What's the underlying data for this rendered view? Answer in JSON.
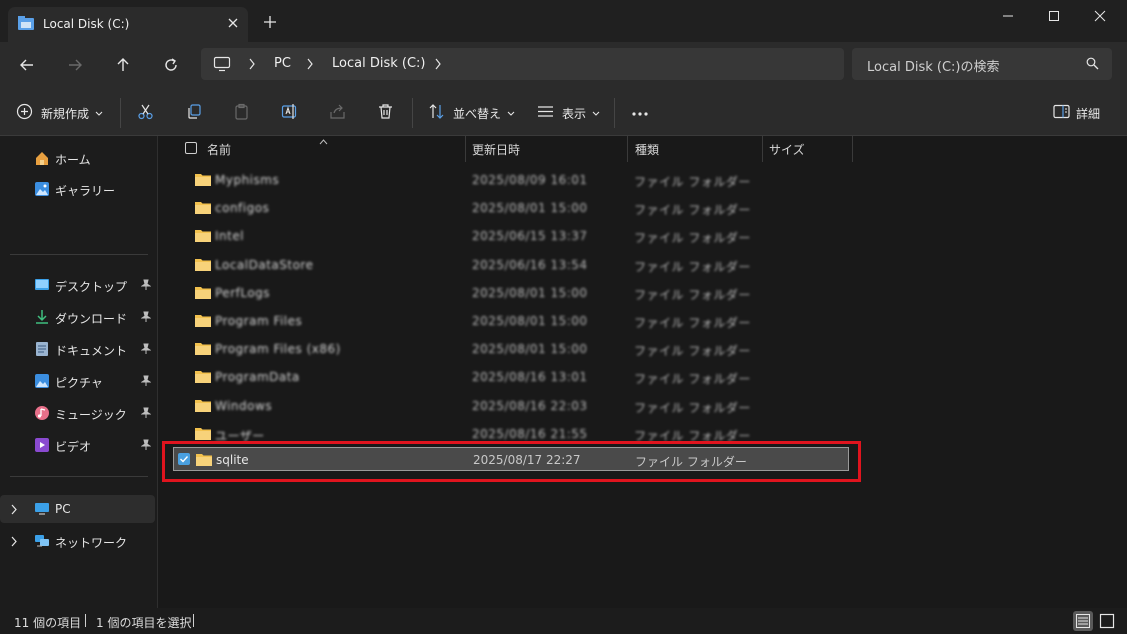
{
  "window": {
    "tab_title": "Local Disk (C:)",
    "controls": [
      "minimize-icon",
      "maximize-icon",
      "close-icon"
    ]
  },
  "nav": {
    "breadcrumb": [
      "PC",
      "Local Disk (C:)"
    ],
    "search_placeholder": "Local Disk (C:)の検索"
  },
  "toolbar": {
    "new_label": "新規作成",
    "sort_label": "並べ替え",
    "view_label": "表示",
    "details_label": "詳細"
  },
  "sidebar": {
    "top": [
      {
        "label": "ホーム",
        "icon": "home-icon"
      },
      {
        "label": "ギャラリー",
        "icon": "gallery-icon"
      }
    ],
    "pinned": [
      {
        "label": "デスクトップ",
        "icon": "desktop-icon"
      },
      {
        "label": "ダウンロード",
        "icon": "download-icon"
      },
      {
        "label": "ドキュメント",
        "icon": "document-icon"
      },
      {
        "label": "ピクチャ",
        "icon": "pictures-icon"
      },
      {
        "label": "ミュージック",
        "icon": "music-icon"
      },
      {
        "label": "ビデオ",
        "icon": "video-icon"
      }
    ],
    "locations": [
      {
        "label": "PC",
        "icon": "pc-icon"
      },
      {
        "label": "ネットワーク",
        "icon": "network-icon"
      }
    ]
  },
  "columns": {
    "name": "名前",
    "modified": "更新日時",
    "type": "種類",
    "size": "サイズ"
  },
  "files": [
    {
      "name": "Myphisms",
      "date": "2025/08/09 16:01",
      "type": "ファイル フォルダー"
    },
    {
      "name": "configos",
      "date": "2025/08/01 15:00",
      "type": "ファイル フォルダー"
    },
    {
      "name": "Intel",
      "date": "2025/06/15 13:37",
      "type": "ファイル フォルダー"
    },
    {
      "name": "LocalDataStore",
      "date": "2025/06/16 13:54",
      "type": "ファイル フォルダー"
    },
    {
      "name": "PerfLogs",
      "date": "2025/08/01 15:00",
      "type": "ファイル フォルダー"
    },
    {
      "name": "Program Files",
      "date": "2025/08/01 15:00",
      "type": "ファイル フォルダー"
    },
    {
      "name": "Program Files (x86)",
      "date": "2025/08/01 15:00",
      "type": "ファイル フォルダー"
    },
    {
      "name": "ProgramData",
      "date": "2025/08/16 13:01",
      "type": "ファイル フォルダー"
    },
    {
      "name": "Windows",
      "date": "2025/08/16 22:03",
      "type": "ファイル フォルダー"
    },
    {
      "name": "ユーザー",
      "date": "2025/08/16 21:55",
      "type": "ファイル フォルダー"
    },
    {
      "name": "sqlite",
      "date": "2025/08/17 22:27",
      "type": "ファイル フォルダー",
      "selected": true
    }
  ],
  "status": {
    "item_count": "11 個の項目",
    "selected_count": "1 個の項目を選択"
  },
  "colors": {
    "folder": "#f2c14e",
    "highlight": "#e0141e",
    "checkbox": "#4aa0e0"
  }
}
